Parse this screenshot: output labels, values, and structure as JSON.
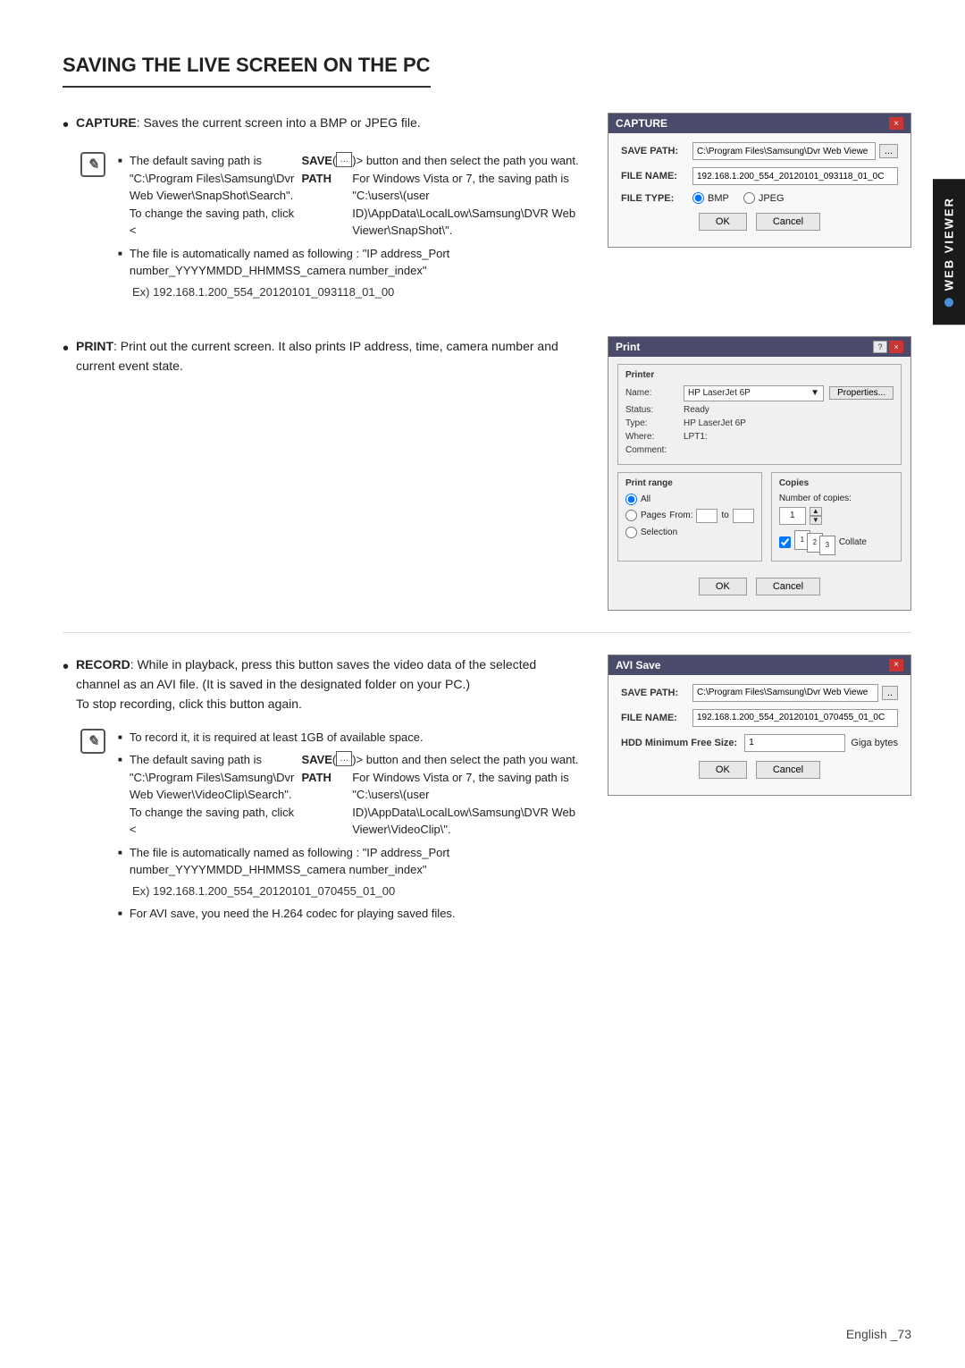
{
  "page": {
    "title": "SAVING THE LIVE SCREEN ON THE PC",
    "footer": "English _73"
  },
  "side_tab": {
    "label": "WEB VIEWER"
  },
  "capture_section": {
    "bullet_label": "CAPTURE",
    "bullet_text": ": Saves the current screen into a BMP or JPEG file.",
    "note_icon": "✎",
    "note_lines": [
      "The default saving path is \"C:\\Program Files\\Samsung\\Dvr Web Viewer\\SnapShot\\Search\". To change the saving path, click <SAVE PATH ( )> button and then select the path you want. For Windows Vista or 7, the saving path is \"C:\\users\\(user ID)\\AppData\\LocalLow\\Samsung\\DVR Web Viewer\\SnapShot\\\".",
      "The file is automatically named as following : \"IP address_Port number_YYYYMMDD_HHMMSS_camera number_index\""
    ],
    "example_prefix": "Ex) ",
    "example_value": "192.168.1.200_554_20120101_093118_01_00",
    "dialog": {
      "title": "CAPTURE",
      "close_btn": "×",
      "save_path_label": "SAVE PATH:",
      "save_path_value": "C:\\Program Files\\Samsung\\Dvr Web Viewe",
      "browse_btn": "...",
      "file_name_label": "FILE NAME:",
      "file_name_value": "192.168.1.200_554_20120101_093118_01_0C",
      "file_type_label": "FILE TYPE:",
      "radio_bmp": "BMP",
      "radio_jpeg": "JPEG",
      "ok_btn": "OK",
      "cancel_btn": "Cancel"
    }
  },
  "print_section": {
    "bullet_label": "PRINT",
    "bullet_text": ": Print out the current screen. It also prints IP address, time, camera number and current event state.",
    "dialog": {
      "title": "Print",
      "close_question": "?",
      "close_x": "×",
      "printer_section_label": "Printer",
      "name_label": "Name:",
      "name_value": "HP LaserJet 6P",
      "properties_btn": "Properties...",
      "status_label": "Status:",
      "status_value": "Ready",
      "type_label": "Type:",
      "type_value": "HP LaserJet 6P",
      "where_label": "Where:",
      "where_value": "LPT1:",
      "comment_label": "Comment:",
      "comment_value": "",
      "print_range_label": "Print range",
      "copies_label": "Copies",
      "radio_all": "All",
      "radio_pages": "Pages",
      "from_label": "From:",
      "to_label": "to",
      "radio_selection": "Selection",
      "copies_count_label": "Number of copies:",
      "copies_value": "1",
      "collate_label": "Collate",
      "ok_btn": "OK",
      "cancel_btn": "Cancel"
    }
  },
  "record_section": {
    "bullet_label": "RECORD",
    "bullet_text": ": While in playback, press this button saves the video data of the selected channel as an AVI file. (It is saved in the designated folder on your PC.)",
    "stop_text": "To stop recording, click this button again.",
    "note_lines": [
      "To record it, it is required at least 1GB of available space.",
      "The default saving path is \"C:\\Program Files\\Samsung\\Dvr Web Viewer\\VideoClip\\Search\". To change the saving path, click <SAVE PATH ( )> button and then select the path you want. For Windows Vista or 7, the saving path is \"C:\\users\\(user ID)\\AppData\\LocalLow\\Samsung\\DVR Web Viewer\\VideoClip\\\".",
      "The file is automatically named as following : \"IP address_Port number_YYYYMMDD_HHMMSS_camera number_index\"",
      "For AVI save, you need the H.264 codec for playing saved files."
    ],
    "example_prefix": "Ex) ",
    "example_value": "192.168.1.200_554_20120101_070455_01_00",
    "dialog": {
      "title": "AVI Save",
      "close_btn": "×",
      "save_path_label": "SAVE PATH:",
      "save_path_value": "C:\\Program Files\\Samsung\\Dvr Web Viewe",
      "browse_btn": "..",
      "file_name_label": "FILE NAME:",
      "file_name_value": "192.168.1.200_554_20120101_070455_01_0C",
      "hdd_label": "HDD Minimum Free Size:",
      "hdd_value": "1",
      "hdd_unit": "Giga bytes",
      "ok_btn": "OK",
      "cancel_btn": "Cancel"
    }
  }
}
